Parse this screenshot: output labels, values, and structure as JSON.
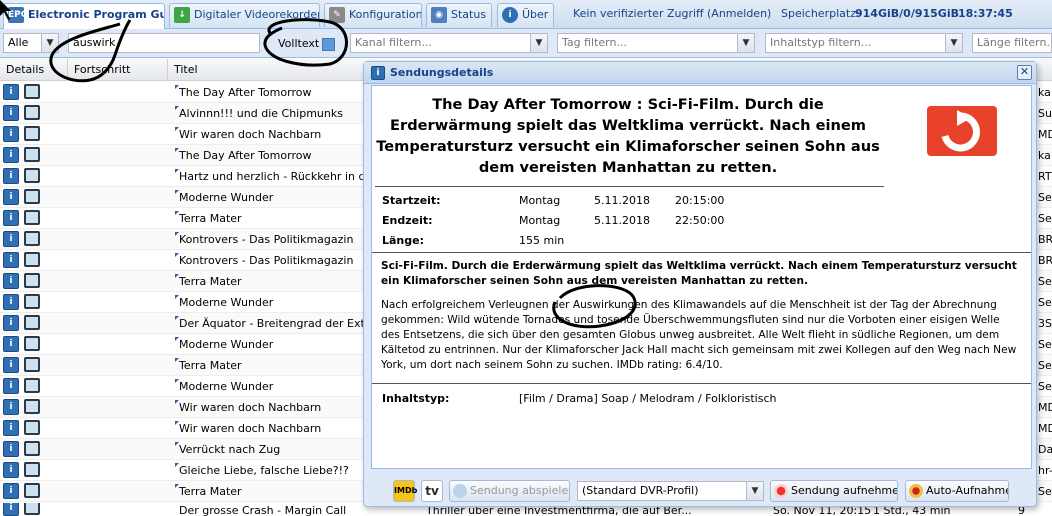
{
  "tabs": [
    {
      "label": "Electronic Program Guide",
      "icon": "epg-icon",
      "active": true
    },
    {
      "label": "Digitaler Videorekorder",
      "icon": "download-icon"
    },
    {
      "label": "Konfiguration",
      "icon": "wrench-icon"
    },
    {
      "label": "Status",
      "icon": "eye-icon"
    },
    {
      "label": "Über",
      "icon": "info-icon"
    }
  ],
  "status": {
    "access": "Kein verifizierter Zugriff",
    "login": "(Anmelden)",
    "storage_label": "Speicherplatz:",
    "storage_value": "914GiB/0/915GiB",
    "time": "18:37:45"
  },
  "filters": {
    "all_value": "Alle",
    "search_value": "auswirk",
    "fulltext_label": "Volltext",
    "channel_placeholder": "Kanal filtern...",
    "tag_placeholder": "Tag filtern...",
    "contenttype_placeholder": "Inhaltstyp filtern...",
    "length_placeholder": "Länge filtern..."
  },
  "columns": {
    "details": "Details",
    "progress": "Fortschritt",
    "title": "Titel"
  },
  "rows": [
    {
      "title": "The Day After Tomorrow",
      "right": "ka"
    },
    {
      "title": "Alvinnn!!! und die Chipmunks",
      "right": "Su"
    },
    {
      "title": "Wir waren doch Nachbarn",
      "right": "MD"
    },
    {
      "title": "The Day After Tomorrow",
      "right": "ka"
    },
    {
      "title": "Hartz und herzlich - Rückkehr in die B",
      "right": "RT"
    },
    {
      "title": "Moderne Wunder",
      "right": "Se"
    },
    {
      "title": "Terra Mater",
      "right": "Se"
    },
    {
      "title": "Kontrovers - Das Politikmagazin",
      "right": "BR"
    },
    {
      "title": "Kontrovers - Das Politikmagazin",
      "right": "BR"
    },
    {
      "title": "Terra Mater",
      "right": "Se"
    },
    {
      "title": "Moderne Wunder",
      "right": "Se"
    },
    {
      "title": "Der Äquator - Breitengrad der Extreme",
      "right": "3S"
    },
    {
      "title": "Moderne Wunder",
      "right": "Se"
    },
    {
      "title": "Terra Mater",
      "right": "Se"
    },
    {
      "title": "Moderne Wunder",
      "right": "Se"
    },
    {
      "title": "Wir waren doch Nachbarn",
      "right": "MD"
    },
    {
      "title": "Wir waren doch Nachbarn",
      "right": "MD"
    },
    {
      "title": "Verrückt nach Zug",
      "right": "Da"
    },
    {
      "title": "Gleiche Liebe, falsche Liebe?!?",
      "right": "hr-"
    },
    {
      "title": "Terra Mater",
      "right": "Se"
    }
  ],
  "last_row": {
    "title": "Der grosse Crash - Margin Call",
    "extra": "Thriller über eine Investmentfirma, die auf Ber...",
    "date": "So. Nov 11, 20:15",
    "count": "1 Std., 43 min",
    "channel": "9"
  },
  "dialog": {
    "header": "Sendungsdetails",
    "title": "The Day After Tomorrow : Sci-Fi-Film. Durch die Erderwärmung spielt das Weltklima verrückt. Nach einem Temperatursturz versucht ein Klimaforscher seinen Sohn aus dem vereisten Manhattan zu retten.",
    "start_label": "Startzeit:",
    "start_day": "Montag",
    "start_date": "5.11.2018",
    "start_time": "20:15:00",
    "end_label": "Endzeit:",
    "end_day": "Montag",
    "end_date": "5.11.2018",
    "end_time": "22:50:00",
    "length_label": "Länge:",
    "length_value": "155 min",
    "summary": "Sci-Fi-Film. Durch die Erderwärmung spielt das Weltklima verrückt. Nach einem Temperatursturz versucht ein Klimaforscher seinen Sohn aus dem vereisten Manhattan zu retten.",
    "description": "Nach erfolgreichem Verleugnen der Auswirkungen des Klimawandels auf die Menschheit ist der Tag der Abrechnung gekommen: Wild wütende Tornados und tosende Überschwemmungsfluten sind nur die Vorboten einer eisigen Welle des Entsetzens, die sich über den gesamten Globus unweg ausbreitet. Alle Welt flieht in südliche Regionen, um dem Kältetod zu entrinnen. Nur der Klimaforscher Jack Hall macht sich gemeinsam mit zwei Kollegen auf den Weg nach New York, um dort nach seinem Sohn zu suchen. IMDb rating: 6.4/10.",
    "contenttype_label": "Inhaltstyp:",
    "contenttype_value": "[Film / Drama] Soap / Melodram / Folkloristisch",
    "imdb": "IMDb",
    "tv": "tv",
    "play_button": "Sendung abspielen",
    "profile_value": "(Standard DVR-Profil)",
    "record_button": "Sendung aufnehmen",
    "autorec_button": "Auto-Aufnahme"
  },
  "colors": {
    "accent": "#15428b",
    "logo": "#e8432a"
  }
}
